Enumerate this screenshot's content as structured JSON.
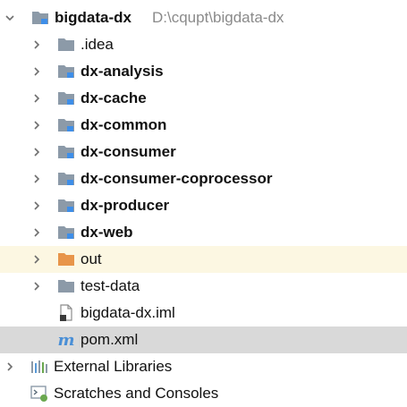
{
  "project": {
    "name": "bigdata-dx",
    "path": "D:\\cqupt\\bigdata-dx"
  },
  "children": [
    {
      "label": ".idea",
      "bold": false,
      "icon": "folder-icon"
    },
    {
      "label": "dx-analysis",
      "bold": true,
      "icon": "module-folder-icon"
    },
    {
      "label": "dx-cache",
      "bold": true,
      "icon": "module-folder-icon"
    },
    {
      "label": "dx-common",
      "bold": true,
      "icon": "module-folder-icon"
    },
    {
      "label": "dx-consumer",
      "bold": true,
      "icon": "module-folder-icon"
    },
    {
      "label": "dx-consumer-coprocessor",
      "bold": true,
      "icon": "module-folder-icon"
    },
    {
      "label": "dx-producer",
      "bold": true,
      "icon": "module-folder-icon"
    },
    {
      "label": "dx-web",
      "bold": true,
      "icon": "module-folder-icon"
    },
    {
      "label": "out",
      "bold": false,
      "icon": "excluded-folder-icon"
    },
    {
      "label": "test-data",
      "bold": false,
      "icon": "folder-icon"
    }
  ],
  "files": [
    {
      "label": "bigdata-dx.iml",
      "icon": "iml-file-icon"
    },
    {
      "label": "pom.xml",
      "icon": "maven-icon",
      "glyph": "m"
    }
  ],
  "roots": [
    {
      "label": "External Libraries",
      "icon": "libraries-icon"
    },
    {
      "label": "Scratches and Consoles",
      "icon": "scratches-icon"
    }
  ],
  "colors": {
    "folder": "#8c9aa8",
    "module_marker": "#3e8ee8",
    "excluded_folder": "#e8954a",
    "highlight_yellow": "#fcf7e2",
    "selection": "#d9d9d9",
    "path_text": "#8a8a8a"
  }
}
